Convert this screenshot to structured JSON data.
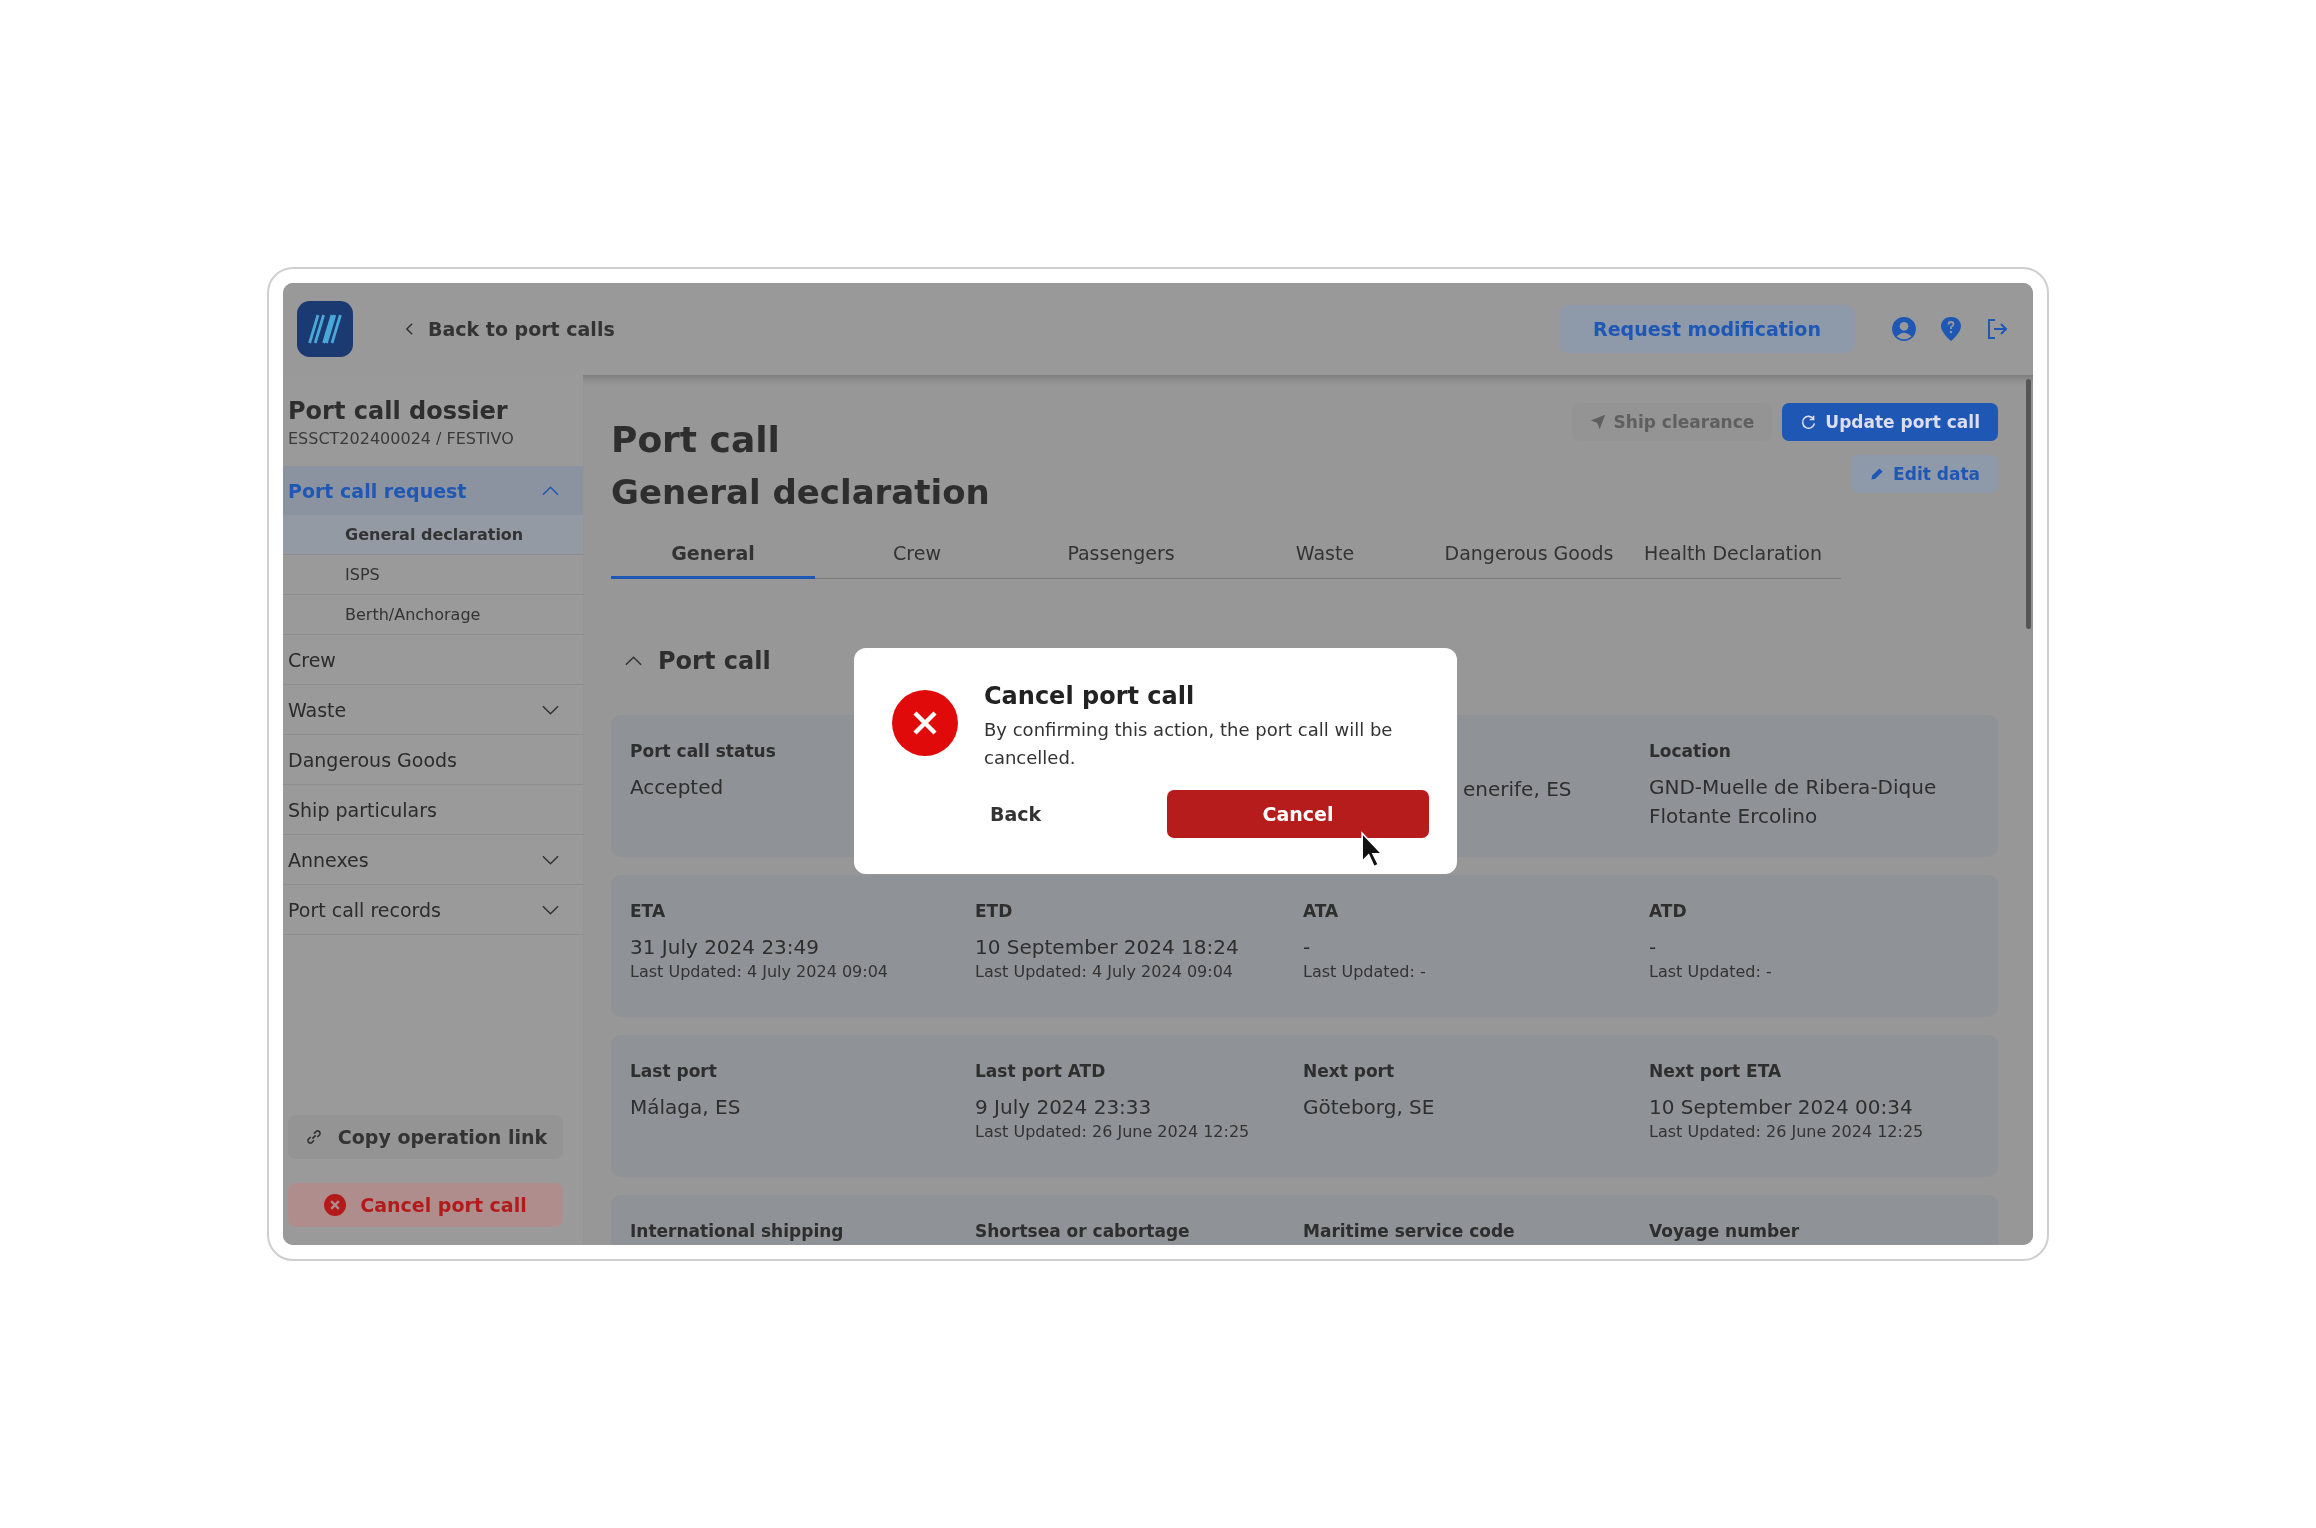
{
  "app_bar": {
    "back_link": "Back to port calls",
    "request_button": "Request modification"
  },
  "sidebar": {
    "title": "Port call dossier",
    "subtitle": "ESSCT202400024 / FESTIVO",
    "items": [
      {
        "label": "Port call request",
        "selected": true,
        "expanded": true,
        "children": [
          {
            "label": "General declaration",
            "selected": true
          },
          {
            "label": "ISPS",
            "selected": false
          },
          {
            "label": "Berth/Anchorage",
            "selected": false
          }
        ]
      },
      {
        "label": "Crew",
        "selected": false
      },
      {
        "label": "Waste",
        "selected": false,
        "expanded": false
      },
      {
        "label": "Dangerous Goods",
        "selected": false
      },
      {
        "label": "Ship particulars",
        "selected": false
      },
      {
        "label": "Annexes",
        "selected": false,
        "expanded": false
      },
      {
        "label": "Port call records",
        "selected": false,
        "expanded": false
      }
    ],
    "copy_link_button": "Copy operation link",
    "cancel_button": "Cancel port call"
  },
  "page": {
    "title": "Port call",
    "subtitle": "General declaration",
    "actions": [
      {
        "label": "Ship clearance",
        "kind": "disabled"
      },
      {
        "label": "Update port call",
        "kind": "primary"
      }
    ],
    "edit_button": "Edit data",
    "tabs": [
      {
        "label": "General",
        "selected": true
      },
      {
        "label": "Crew",
        "selected": false
      },
      {
        "label": "Passengers",
        "selected": false
      },
      {
        "label": "Waste",
        "selected": false
      },
      {
        "label": "Dangerous Goods",
        "selected": false
      },
      {
        "label": "Health Declaration",
        "selected": false
      }
    ],
    "section": {
      "title": "Port call",
      "expanded": true
    },
    "cards": [
      [
        {
          "label": "Port call status",
          "value": "Accepted"
        },
        {
          "value": "enerife, ES",
          "kind": "partial"
        },
        {
          "label": "Location",
          "value": "GND-Muelle de Ribera-Dique Flotante Ercolino"
        }
      ],
      [
        {
          "label": "ETA",
          "value": "31 July 2024 23:49",
          "updated": "Last Updated: 4 July 2024 09:04"
        },
        {
          "label": "ETD",
          "value": "10 September 2024 18:24",
          "updated": "Last Updated: 4 July 2024 09:04"
        },
        {
          "label": "ATA",
          "value": "-",
          "updated": "Last Updated: -"
        },
        {
          "label": "ATD",
          "value": "-",
          "updated": "Last Updated: -"
        }
      ],
      [
        {
          "label": "Last port",
          "value": "Málaga, ES"
        },
        {
          "label": "Last port ATD",
          "value": "9 July 2024 23:33",
          "updated": "Last Updated: 26 June 2024 12:25"
        },
        {
          "label": "Next port",
          "value": "Göteborg, SE"
        },
        {
          "label": "Next port ETA",
          "value": "10 September 2024 00:34",
          "updated": "Last Updated: 26 June 2024 12:25"
        }
      ],
      [
        {
          "label": "International shipping"
        },
        {
          "label": "Shortsea or cabortage"
        },
        {
          "label": "Maritime service code"
        },
        {
          "label": "Voyage number"
        }
      ]
    ]
  },
  "dialog": {
    "title": "Cancel port call",
    "message": "By confirming this action, the port call will be cancelled.",
    "back_button": "Back",
    "confirm_button": "Cancel"
  }
}
